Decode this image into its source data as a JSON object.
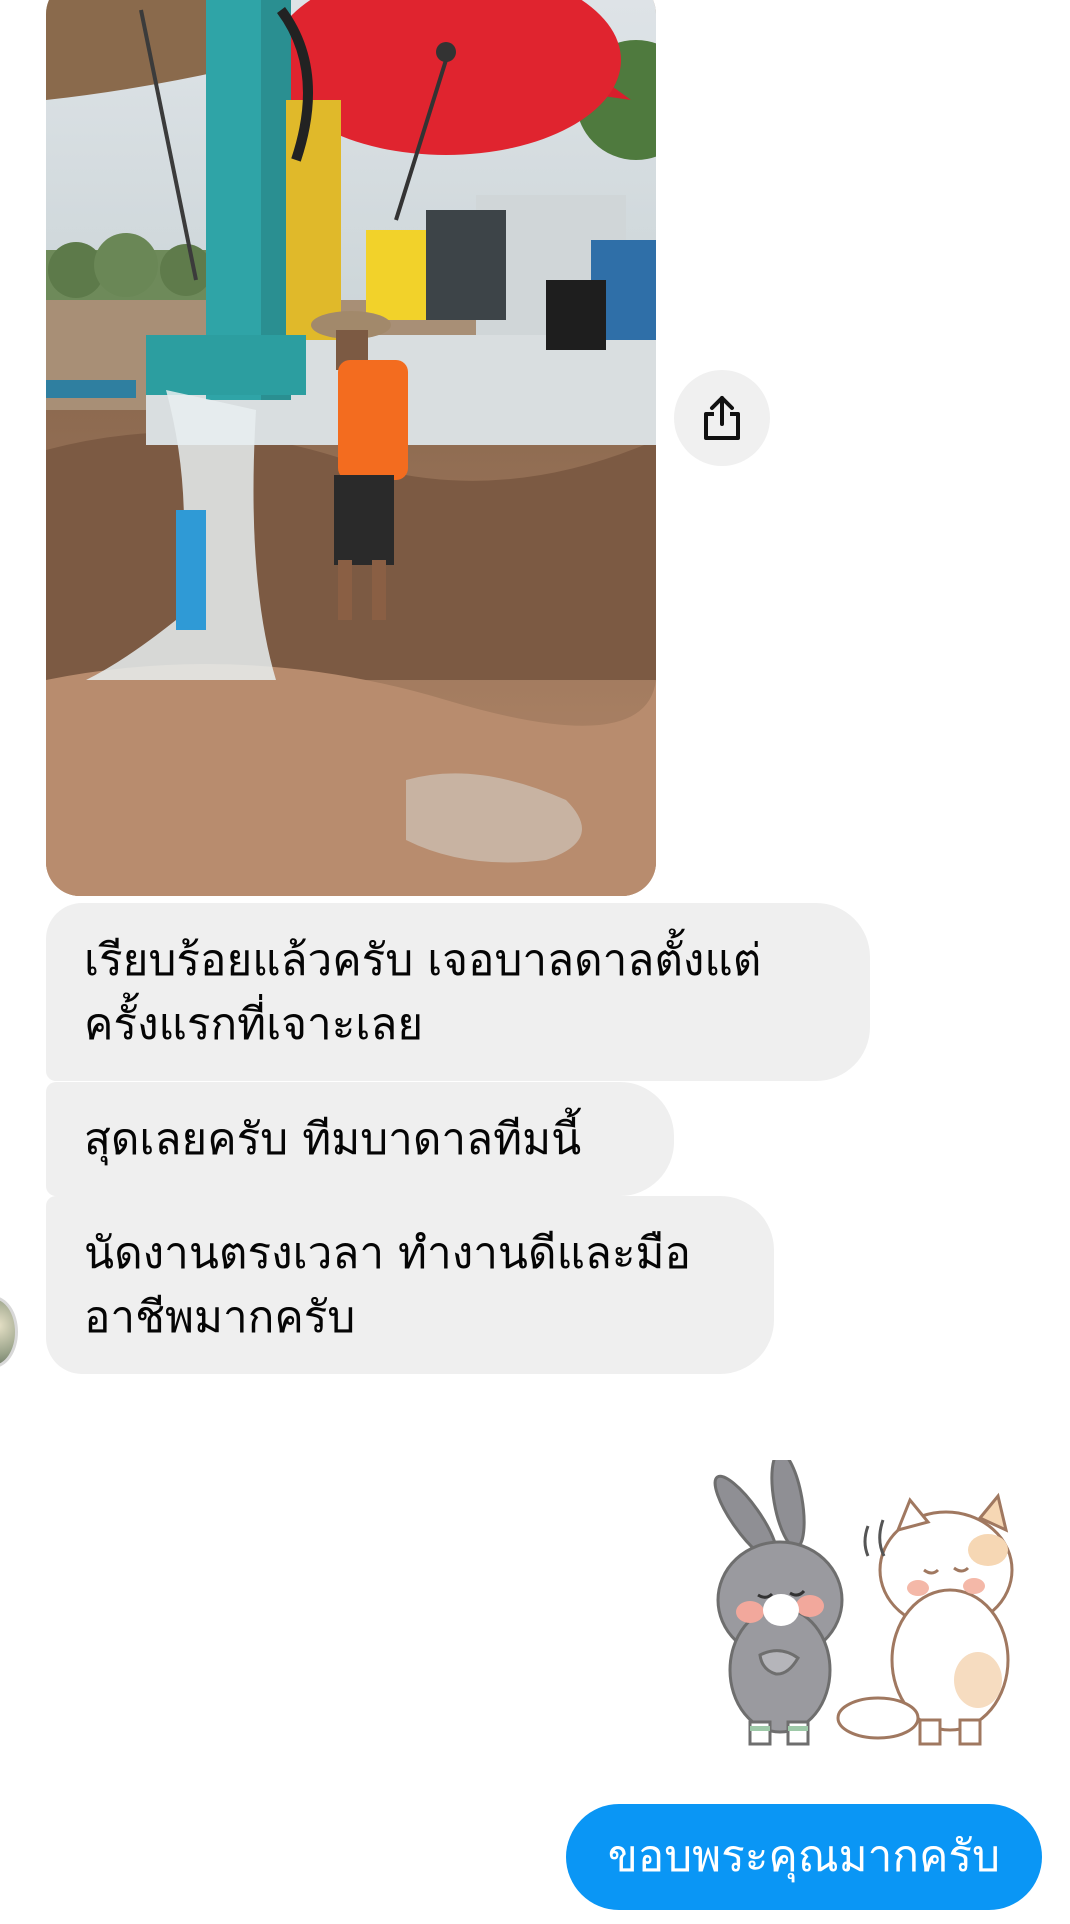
{
  "messages": [
    {
      "sender": "them",
      "type": "image",
      "icon": "photo-well-drilling"
    },
    {
      "sender": "them",
      "type": "text",
      "text": "เรียบร้อยแล้วครับ เจอบาลดาลตั้งแต่\nครั้งแรกที่เจาะเลย"
    },
    {
      "sender": "them",
      "type": "text",
      "text": "สุดเลยครับ ทีมบาดาลทีมนี้"
    },
    {
      "sender": "them",
      "type": "text",
      "text": "นัดงานตรงเวลา ทำงานดีและมือ\nอาชีพมากครับ"
    },
    {
      "sender": "me",
      "type": "sticker",
      "icon": "bunny-and-cat-thank-you-sticker"
    },
    {
      "sender": "me",
      "type": "text",
      "text": "ขอบพระคุณมากครับ"
    }
  ],
  "share_button": {
    "icon": "share-icon"
  },
  "colors": {
    "incoming_bubble": "#efefef",
    "outgoing_bubble": "#0a96f5",
    "text_dark": "#050505",
    "text_light": "#ffffff"
  }
}
